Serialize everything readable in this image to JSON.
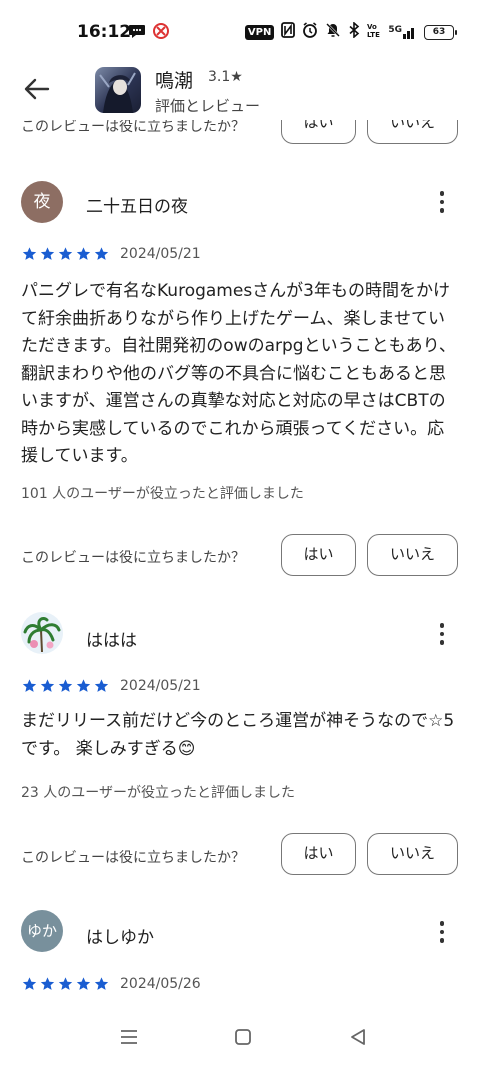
{
  "status_bar": {
    "time": "16:12",
    "vpn": "VPN",
    "network": "5G",
    "battery": "63",
    "icons": [
      "chat-bubble-icon",
      "app-notification-icon",
      "nfc-icon",
      "alarm-icon",
      "mute-icon",
      "bluetooth-icon",
      "volte-icon",
      "signal-icon",
      "battery-icon"
    ]
  },
  "header": {
    "app_name": "鳴潮",
    "rating": "3.1★",
    "subtitle": "評価とレビュー"
  },
  "previous_feedback": {
    "question": "このレビューは役に立ちましたか？",
    "yes": "はい",
    "no": "いいえ"
  },
  "reviews": [
    {
      "avatar_text": "夜",
      "avatar_color": "#8d6e63",
      "name": "二十五日の夜",
      "stars": 5,
      "date": "2024/05/21",
      "body": "パニグレで有名なKurogamesさんが3年もの時間をかけて紆余曲折ありながら作り上げたゲーム、楽しませていただきます。自社開発初のowのarpgということもあり、翻訳まわりや他のバグ等の不具合に悩むこともあると思いますが、運営さんの真摯な対応と対応の早さはCBTの時から実感しているのでこれから頑張ってください。応援しています。",
      "helpful": "101 人のユーザーが役立ったと評価しました",
      "question": "このレビューは役に立ちましたか？",
      "yes": "はい",
      "no": "いいえ"
    },
    {
      "avatar_text": "",
      "avatar_color": "#e8f1f8",
      "name": "ははは",
      "stars": 5,
      "date": "2024/05/21",
      "body": "まだリリース前だけど今のところ運営が神そうなので☆5です。 楽しみすぎる😊",
      "helpful": "23 人のユーザーが役立ったと評価しました",
      "question": "このレビューは役に立ちましたか？",
      "yes": "はい",
      "no": "いいえ"
    },
    {
      "avatar_text": "ゆか",
      "avatar_color": "#78909c",
      "name": "はしゆか",
      "stars": 5,
      "date": "2024/05/26"
    }
  ],
  "colors": {
    "star": "#1a5dd1",
    "button_border": "#777777"
  }
}
